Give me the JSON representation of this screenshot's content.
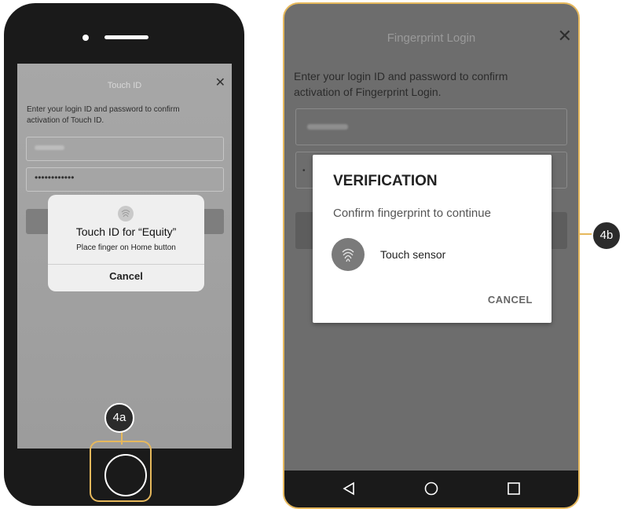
{
  "ios": {
    "screen_title": "Touch ID",
    "close_glyph": "✕",
    "instruction": "Enter your login ID and password to confirm activation of Touch ID.",
    "password_mask": "••••••••••••",
    "alert": {
      "icon": "fingerprint-icon",
      "title": "Touch ID for “Equity”",
      "message": "Place finger on Home button",
      "cancel_label": "Cancel"
    },
    "callout_label": "4a"
  },
  "android": {
    "screen_title": "Fingerprint Login",
    "close_glyph": "✕",
    "instruction": "Enter your login ID and password to confirm activation of Fingerprint Login.",
    "password_mask": "•",
    "dialog": {
      "title": "VERIFICATION",
      "message": "Confirm fingerprint to continue",
      "sensor_icon": "fingerprint-icon",
      "sensor_label": "Touch sensor",
      "cancel_label": "CANCEL"
    },
    "navbar": {
      "back_icon": "back-triangle-icon",
      "home_icon": "home-circle-icon",
      "recent_icon": "recent-square-icon"
    },
    "callout_label": "4b"
  },
  "colors": {
    "highlight": "#e6b85c",
    "phone_body": "#1a1a1a",
    "badge": "#2b2b2b"
  }
}
